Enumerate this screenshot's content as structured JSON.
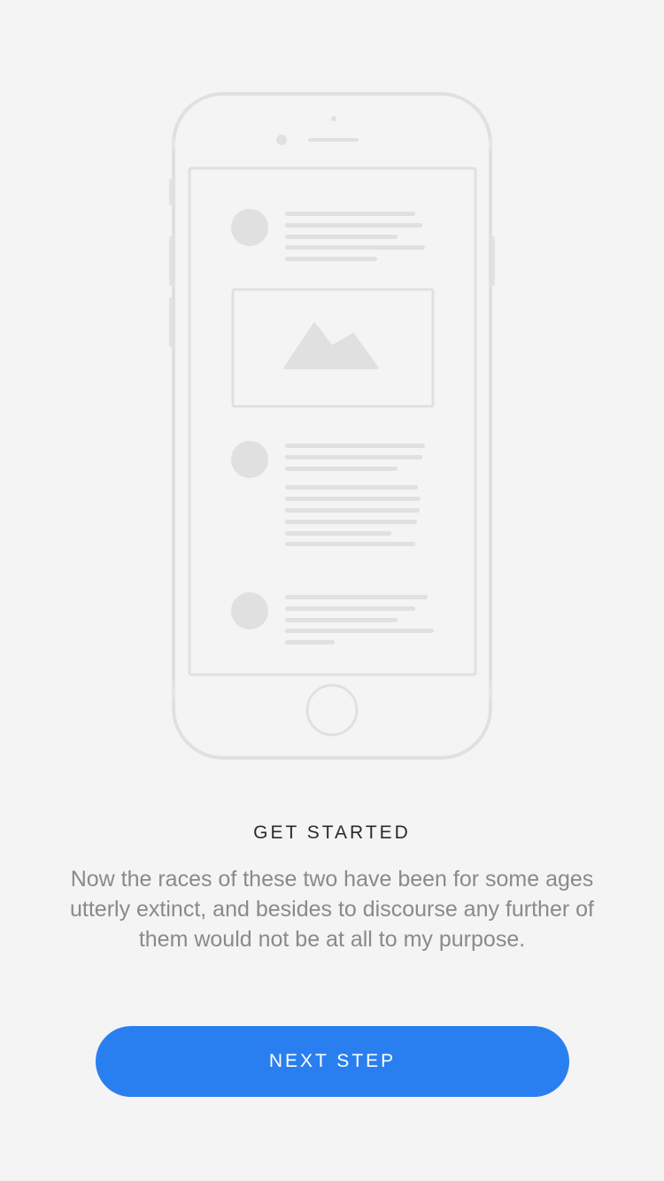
{
  "illustration": {
    "icon": "phone-wireframe-illustration",
    "image_icon": "mountain-image-icon"
  },
  "onboarding": {
    "title": "GET STARTED",
    "description": "Now the races of these two have been for some ages utterly extinct, and besides to discourse any further of them would not be at all to my purpose."
  },
  "actions": {
    "next_label": "NEXT STEP"
  },
  "colors": {
    "background": "#f4f4f4",
    "illustration_stroke": "#e0e0e0",
    "illustration_fill": "#e0e0e0",
    "title": "#2b2b2b",
    "body_text": "#8a8a8a",
    "primary_button": "#2a7ff0",
    "button_text": "#ffffff"
  }
}
